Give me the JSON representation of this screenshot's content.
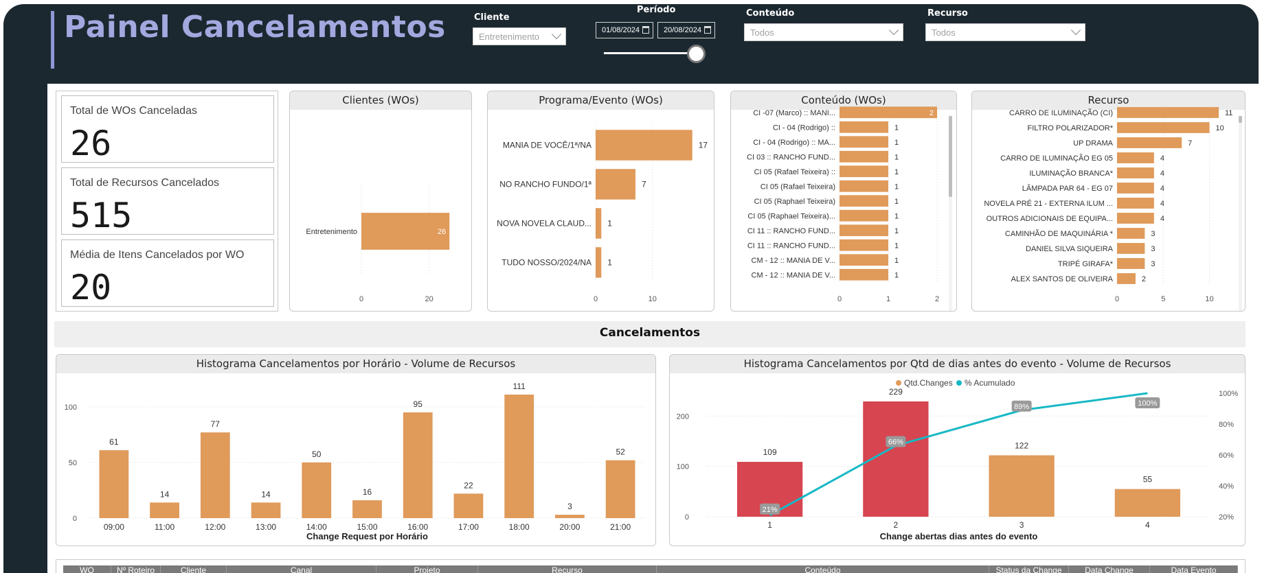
{
  "header": {
    "title": "Painel Cancelamentos",
    "filters": {
      "cliente_label": "Cliente",
      "cliente_value": "Entretenimento",
      "periodo_label": "Período",
      "date_start": "01/08/2024",
      "date_end": "20/08/2024",
      "conteudo_label": "Conteúdo",
      "conteudo_value": "Todos",
      "recurso_label": "Recurso",
      "recurso_value": "Todos"
    }
  },
  "kpis": [
    {
      "label": "Total de WOs Canceladas",
      "value": "26"
    },
    {
      "label": "Total de Recursos Cancelados",
      "value": "515"
    },
    {
      "label": "Média de Itens Cancelados por WO",
      "value": "20"
    }
  ],
  "section_title": "Cancelamentos",
  "table_headers": [
    "WO",
    "Nº Roteiro",
    "Cliente",
    "Canal",
    "Projeto",
    "Recurso",
    "Conteúdo",
    "Status da Change",
    "Data Change",
    "Data Evento"
  ],
  "colors": {
    "bar": "#e09a5a",
    "bar_highlight": "#d64550",
    "line": "#17b8c5",
    "header_bg": "#1b2830",
    "title": "#a3a8df"
  },
  "chart_data": [
    {
      "id": "clientes",
      "type": "bar",
      "orientation": "horizontal",
      "title": "Clientes (WOs)",
      "categories": [
        "Entretenimento"
      ],
      "values": [
        26
      ],
      "xlim": [
        0,
        30
      ],
      "xticks": [
        0,
        20
      ]
    },
    {
      "id": "programa",
      "type": "bar",
      "orientation": "horizontal",
      "title": "Programa/Evento (WOs)",
      "categories": [
        "MANIA DE VOCÊ/1ª/NA",
        "NO RANCHO FUNDO/1ª",
        "NOVA NOVELA CLAUD...",
        "TUDO NOSSO/2024/NA"
      ],
      "values": [
        17,
        7,
        1,
        1
      ],
      "xlim": [
        0,
        18
      ],
      "xticks": [
        0,
        10
      ]
    },
    {
      "id": "conteudo",
      "type": "bar",
      "orientation": "horizontal",
      "title": "Conteúdo (WOs)",
      "categories": [
        "CI -07 (Marco) :: MANI...",
        "CI - 04 (Rodrigo) ::",
        "CI - 04 (Rodrigo) :: MA...",
        "CI 03 :: RANCHO FUND...",
        "CI 05 (Rafael Teixeira) ::",
        "CI 05 (Rafael Teixeira)",
        "CI 05 (Raphael Teixeira)",
        "CI 05 (Raphael Teixeira)...",
        "CI 11 :: RANCHO FUND...",
        "CI 11 :: RANCHO FUND...",
        "CM - 12 :: MANIA DE V...",
        "CM - 12 :: MANIA DE V..."
      ],
      "values": [
        2,
        1,
        1,
        1,
        1,
        1,
        1,
        1,
        1,
        1,
        1,
        1
      ],
      "xlim": [
        0,
        2
      ],
      "xticks": [
        0,
        1,
        2
      ]
    },
    {
      "id": "recurso",
      "type": "bar",
      "orientation": "horizontal",
      "title": "Recurso",
      "categories": [
        "CARRO DE ILUMINAÇÃO (CI)",
        "FILTRO POLARIZADOR*",
        "UP DRAMA",
        "CARRO DE ILUMINAÇÃO EG 05",
        "ILUMINAÇÃO BRANCA*",
        "LÂMPADA PAR 64 - EG 07",
        "NOVELA PRÉ 21 - EXTERNA ILUM ...",
        "OUTROS ADICIONAIS DE EQUIPA...",
        "CAMINHÃO DE MAQUINÁRIA *",
        "DANIEL SILVA SIQUEIRA",
        "TRIPÉ GIRAFA*",
        "ALEX SANTOS DE OLIVEIRA"
      ],
      "values": [
        11,
        10,
        7,
        4,
        4,
        4,
        4,
        4,
        3,
        3,
        3,
        2
      ],
      "xlim": [
        0,
        11
      ],
      "xticks": [
        0,
        5,
        10
      ]
    },
    {
      "id": "horario",
      "type": "bar",
      "title": "Histograma Cancelamentos por Horário - Volume de Recursos",
      "xlabel": "Change Request por Horário",
      "categories": [
        "09:00",
        "11:00",
        "12:00",
        "13:00",
        "14:00",
        "15:00",
        "16:00",
        "17:00",
        "18:00",
        "20:00",
        "21:00"
      ],
      "values": [
        61,
        14,
        77,
        14,
        50,
        16,
        95,
        22,
        111,
        3,
        52
      ],
      "ylim": [
        0,
        111
      ],
      "yticks": [
        0,
        50,
        100
      ]
    },
    {
      "id": "dias",
      "type": "bar",
      "title": "Histograma Cancelamentos por Qtd de dias antes do evento - Volume de Recursos",
      "xlabel": "Change abertas dias antes do evento",
      "legend": [
        "Qtd.Changes",
        "% Acumulado"
      ],
      "categories": [
        "1",
        "2",
        "3",
        "4"
      ],
      "values": [
        109,
        229,
        122,
        55
      ],
      "highlight": [
        true,
        true,
        false,
        false
      ],
      "line_values": [
        21,
        66,
        89,
        100
      ],
      "line_labels": [
        "21%",
        "66%",
        "89%",
        "100%"
      ],
      "ylim": [
        0,
        229
      ],
      "yticks": [
        0,
        100,
        200
      ],
      "y2lim": [
        20,
        100
      ],
      "y2ticks": [
        "20%",
        "40%",
        "60%",
        "80%",
        "100%"
      ]
    }
  ]
}
